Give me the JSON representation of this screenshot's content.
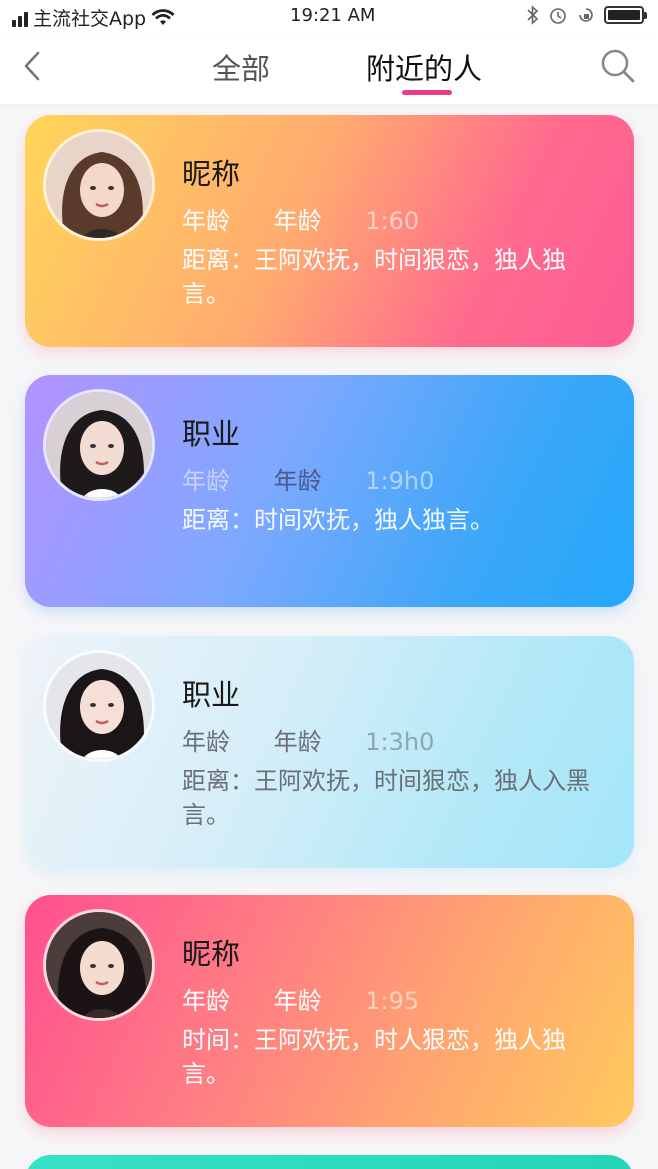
{
  "status_bar": {
    "carrier": "主流社交App",
    "time": "19:21 AM",
    "icons": [
      "signal-icon",
      "wifi-icon",
      "bluetooth-icon",
      "alarm-icon",
      "battery-icon"
    ]
  },
  "nav": {
    "back_icon": "chevron-left-icon",
    "tabs": [
      {
        "label": "全部",
        "active": false
      },
      {
        "label": "附近的人",
        "active": true
      }
    ],
    "search_icon": "search-icon",
    "accent_color": "#ee3a8c"
  },
  "cards": [
    {
      "name": "昵称",
      "age_label1": "年龄",
      "age_label2": "年龄",
      "time": "1:60",
      "bio": "距离：王阿欢抚，时间狠恋，独人独言。",
      "gradient": "yellow-pink"
    },
    {
      "name": "职业",
      "age_label1": "年龄",
      "age_label2": "年龄",
      "time": "1:9h0",
      "bio": "距离：时间欢抚，独人独言。",
      "gradient": "purple-blue"
    },
    {
      "name": "职业",
      "age_label1": "年龄",
      "age_label2": "年龄",
      "time": "1:3h0",
      "bio": "距离：王阿欢抚，时间狠恋，独人入黑言。",
      "gradient": "light-cyan"
    },
    {
      "name": "昵称",
      "age_label1": "年龄",
      "age_label2": "年龄",
      "time": "1:95",
      "bio": "时间：王阿欢抚，时人狠恋，独人独言。",
      "gradient": "pink-orange"
    }
  ]
}
